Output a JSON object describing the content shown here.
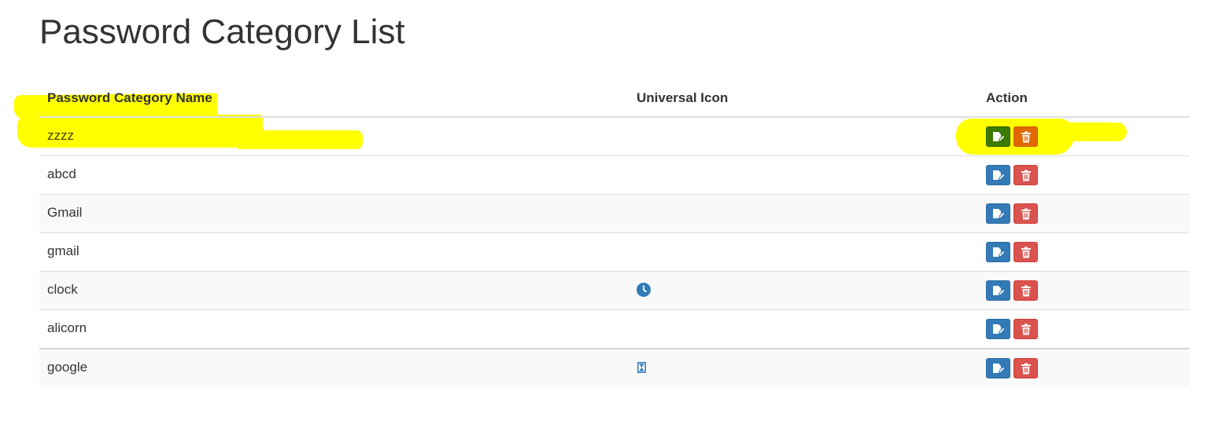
{
  "page": {
    "title": "Password Category List"
  },
  "table": {
    "headers": {
      "name": "Password Category Name",
      "icon": "Universal Icon",
      "action": "Action"
    },
    "rows": [
      {
        "name": "zzzz",
        "icon": "",
        "highlighted": true
      },
      {
        "name": "abcd",
        "icon": ""
      },
      {
        "name": "Gmail",
        "icon": ""
      },
      {
        "name": "gmail",
        "icon": ""
      },
      {
        "name": "clock",
        "icon": "clock-icon"
      },
      {
        "name": "alicorn",
        "icon": ""
      },
      {
        "name": "google",
        "icon": "hourglass-icon"
      }
    ]
  },
  "colors": {
    "edit_button": "#337ab7",
    "delete_button": "#d9534f",
    "highlight": "#ffff00",
    "universal_icon": "#337ab7"
  }
}
